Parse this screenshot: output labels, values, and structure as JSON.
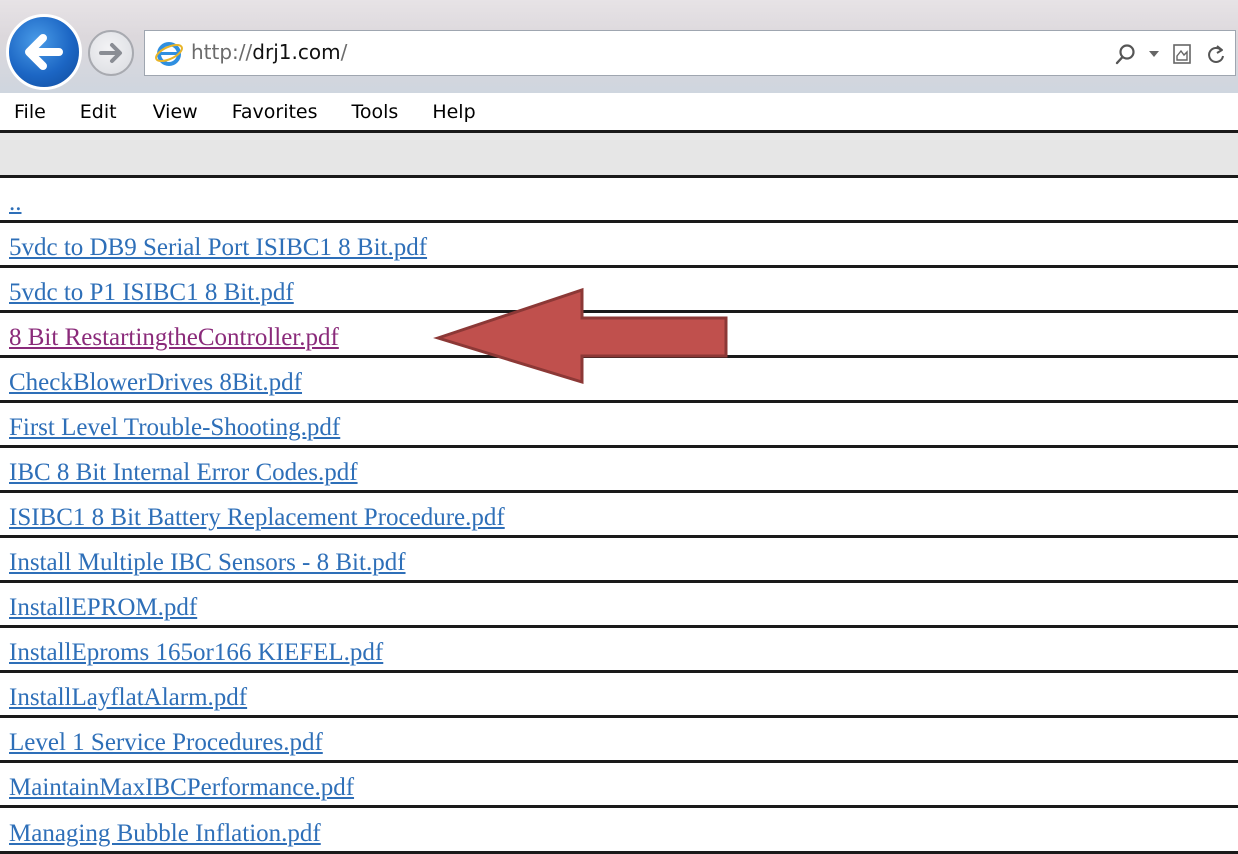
{
  "browser": {
    "url_prefix": "http://",
    "url_host": "drj1.com",
    "url_suffix": "/"
  },
  "menu": [
    "File",
    "Edit",
    "View",
    "Favorites",
    "Tools",
    "Help"
  ],
  "listing": {
    "parent_link": "..",
    "files": [
      "5vdc to DB9 Serial Port ISIBC1 8 Bit.pdf",
      "5vdc to P1 ISIBC1 8 Bit.pdf",
      "8 Bit RestartingtheController.pdf",
      "CheckBlowerDrives  8Bit.pdf",
      "First Level Trouble-Shooting.pdf",
      "IBC 8 Bit Internal Error Codes.pdf",
      "ISIBC1 8 Bit Battery Replacement Procedure.pdf",
      "Install Multiple IBC Sensors - 8 Bit.pdf",
      "InstallEPROM.pdf",
      "InstallEproms  165or166  KIEFEL.pdf",
      "InstallLayflatAlarm.pdf",
      "Level 1 Service Procedures.pdf",
      "MaintainMaxIBCPerformance.pdf",
      "Managing Bubble Inflation.pdf"
    ],
    "visited_file": "8 Bit RestartingtheController.pdf"
  },
  "colors": {
    "link": "#2e6fb8",
    "visited_link": "#8a2a7a",
    "arrow_fill": "#c0504d",
    "arrow_stroke": "#8c3836"
  },
  "icons": {
    "back": "back-arrow-icon",
    "forward": "forward-arrow-icon",
    "site": "ie-logo-icon",
    "search": "search-icon",
    "dropdown": "dropdown-caret-icon",
    "compat": "compatibility-view-icon",
    "refresh": "refresh-icon"
  }
}
